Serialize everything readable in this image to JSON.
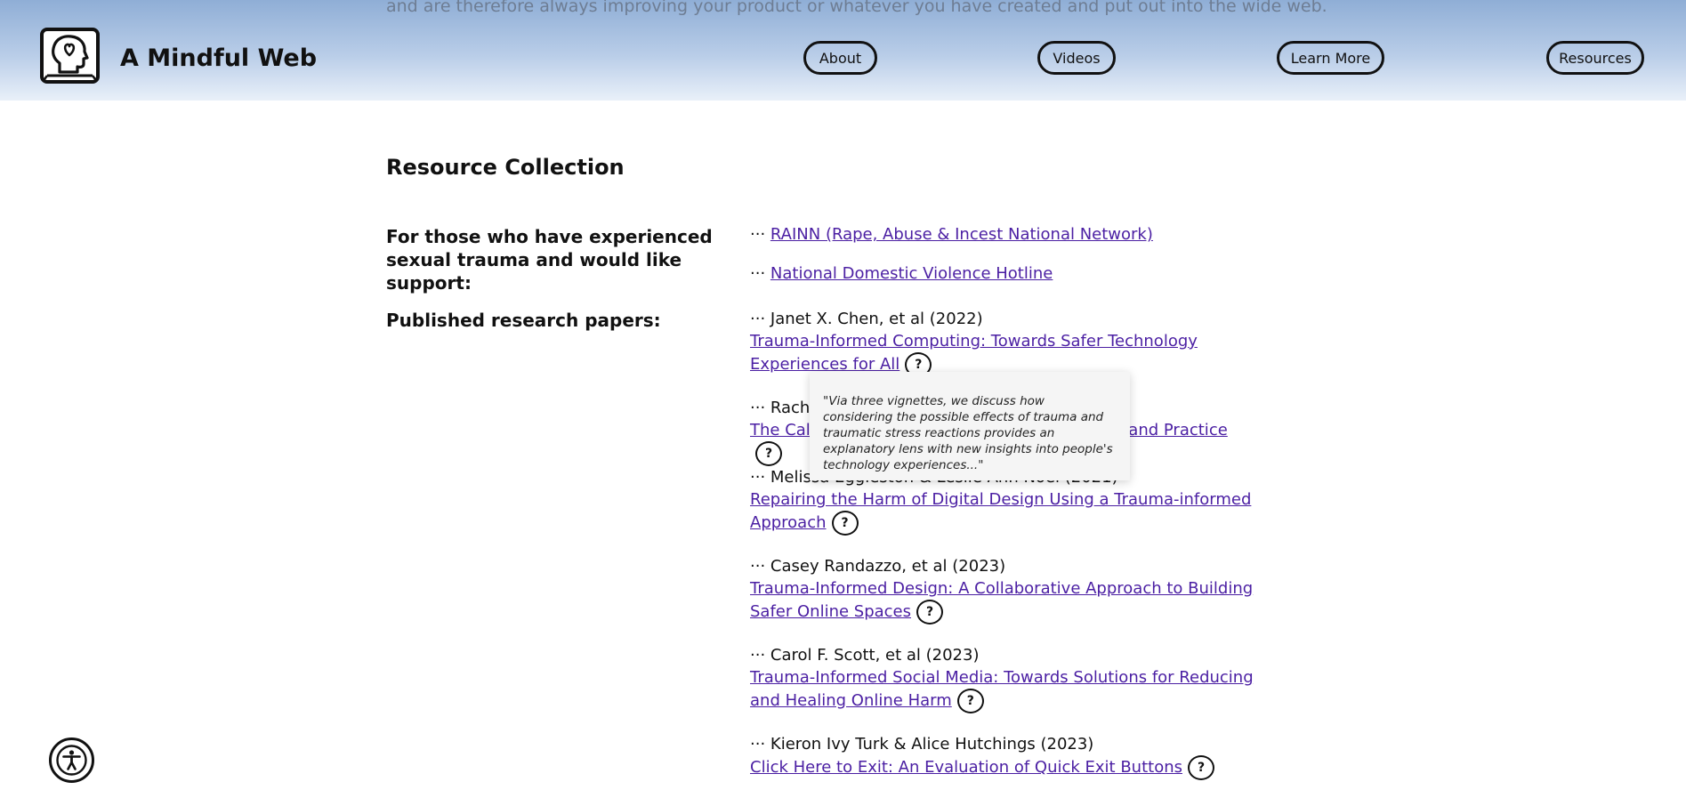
{
  "header": {
    "scroll_text": "and are therefore always improving your product or whatever you have created and put out into the wide web.",
    "site_title": "A Mindful Web",
    "nav": [
      "About",
      "Videos",
      "Learn More",
      "Resources"
    ]
  },
  "main": {
    "section_title": "Resource Collection",
    "support_label": "For those who have experienced sexual trauma and would like support:",
    "support_links": [
      {
        "prefix": "··· ",
        "text": "RAINN (Rape, Abuse & Incest National Network)"
      },
      {
        "prefix": "··· ",
        "text": "National Domestic Violence Hotline"
      }
    ],
    "papers_label": "Published research papers:",
    "papers": [
      {
        "author": "··· Janet X. Chen, et al (2022)",
        "title": "Trauma-Informed Computing: Towards Safer Technology Experiences for All",
        "help": "?"
      },
      {
        "author": "··· Rachael",
        "title": "The Call for Trauma-Informed Design Research and Practice",
        "help": "?"
      },
      {
        "author": "··· Melissa Eggleston & Leslie Ann Noel (2021)",
        "title": "Repairing the Harm of Digital Design Using a Trauma-informed Approach",
        "help": "?"
      },
      {
        "author": "··· Casey Randazzo, et al (2023)",
        "title": "Trauma-Informed Design: A Collaborative Approach to Building Safer Online Spaces",
        "help": "?"
      },
      {
        "author": "··· Carol F. Scott, et al (2023)",
        "title": "Trauma-Informed Social Media: Towards Solutions for Reducing and Healing Online Harm",
        "help": "?"
      },
      {
        "author": "··· Kieron Ivy Turk & Alice Hutchings (2023)",
        "title": "Click Here to Exit: An Evaluation of Quick Exit Buttons",
        "help": "?"
      }
    ],
    "tooltip": "\"Via three vignettes, we discuss how considering the possible effects of trauma and traumatic stress reactions provides an explanatory lens with new insights into people's technology experiences...\""
  },
  "icons": {
    "logo": "head-heart-icon",
    "accessibility": "accessibility-icon"
  },
  "colors": {
    "link": "#4b1fa3",
    "header_top": "#8faed6",
    "header_bottom": "#e9f0f9"
  }
}
